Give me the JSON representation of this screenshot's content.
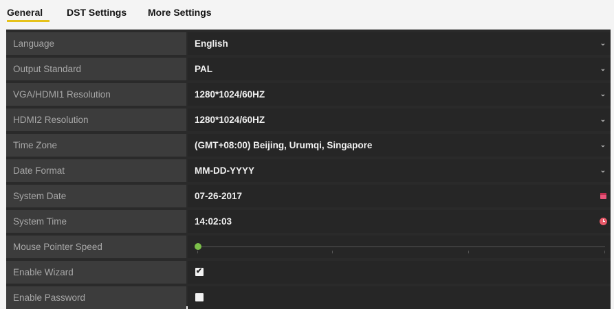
{
  "tabs": [
    {
      "label": "General",
      "active": true
    },
    {
      "label": "DST Settings",
      "active": false
    },
    {
      "label": "More Settings",
      "active": false
    }
  ],
  "rows": [
    {
      "label": "Language",
      "value": "English",
      "control": "dropdown"
    },
    {
      "label": "Output Standard",
      "value": "PAL",
      "control": "dropdown"
    },
    {
      "label": "VGA/HDMI1 Resolution",
      "value": "1280*1024/60HZ",
      "control": "dropdown"
    },
    {
      "label": "HDMI2 Resolution",
      "value": "1280*1024/60HZ",
      "control": "dropdown"
    },
    {
      "label": "Time Zone",
      "value": "(GMT+08:00) Beijing, Urumqi, Singapore",
      "control": "dropdown"
    },
    {
      "label": "Date Format",
      "value": "MM-DD-YYYY",
      "control": "dropdown"
    },
    {
      "label": "System Date",
      "value": "07-26-2017",
      "control": "date",
      "icon": "calendar-icon"
    },
    {
      "label": "System Time",
      "value": "14:02:03",
      "control": "time",
      "icon": "clock-icon"
    },
    {
      "label": "Mouse Pointer Speed",
      "control": "slider",
      "level": 0.0
    },
    {
      "label": "Enable Wizard",
      "control": "checkbox",
      "checked": true
    },
    {
      "label": "Enable Password",
      "control": "checkbox",
      "checked": false
    }
  ],
  "colors": {
    "tab_accent": "#e6c21a",
    "slider_thumb": "#7cc04a",
    "calendar_icon": "#e8557a",
    "clock_icon": "#e85a6a"
  }
}
